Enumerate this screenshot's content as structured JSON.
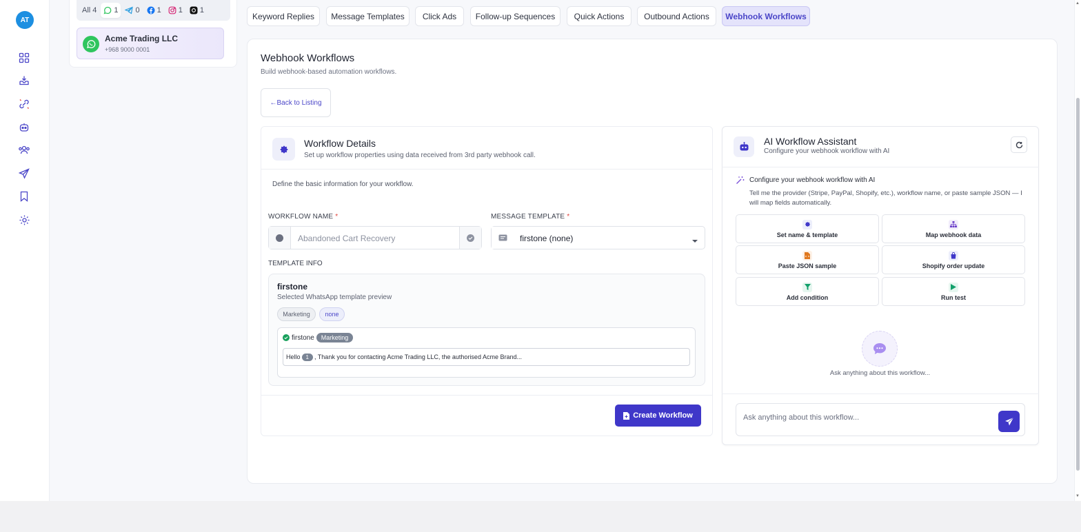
{
  "user": {
    "initials": "AT"
  },
  "rail": [
    "dashboard-icon",
    "inbox-icon",
    "integrations-icon",
    "bot-icon",
    "contacts-icon",
    "send-icon",
    "bookmark-icon",
    "settings-icon"
  ],
  "channels": {
    "tabs": [
      {
        "label": "All",
        "count": "4",
        "icon": "all"
      },
      {
        "label": "",
        "count": "1",
        "icon": "whatsapp-icon"
      },
      {
        "label": "",
        "count": "0",
        "icon": "telegram-icon"
      },
      {
        "label": "",
        "count": "1",
        "icon": "facebook-icon"
      },
      {
        "label": "",
        "count": "1",
        "icon": "instagram-icon"
      },
      {
        "label": "",
        "count": "1",
        "icon": "threads-icon"
      }
    ],
    "card": {
      "name": "Acme Trading LLC",
      "phone": "+968 9000 0001"
    }
  },
  "top_tabs": [
    "Keyword Replies",
    "Message Templates",
    "Click Ads",
    "Follow-up Sequences",
    "Quick Actions",
    "Outbound Actions",
    "Webhook Workflows"
  ],
  "page": {
    "title": "Webhook Workflows",
    "subtitle": "Build webhook-based automation workflows.",
    "back_label": "Back to Listing"
  },
  "workflow": {
    "title": "Workflow Details",
    "subtitle": "Set up workflow properties using data received from 3rd party webhook call.",
    "define": "Define the basic information for your workflow.",
    "name_label": "WORKFLOW NAME",
    "name_placeholder": "Abandoned Cart Recovery",
    "template_label": "MESSAGE TEMPLATE",
    "template_value": "firstone (none)",
    "required_mark": "*",
    "template_info_label": "TEMPLATE INFO",
    "template_name": "firstone",
    "template_desc": "Selected WhatsApp template preview",
    "chips": [
      "Marketing",
      "none"
    ],
    "preview_name": "firstone",
    "preview_badge": "Marketing",
    "preview_hello": "Hello",
    "preview_var": "1",
    "preview_text": ", Thank you for contacting Acme Trading LLC, the authorised Acme Brand...",
    "create_label": "Create Workflow"
  },
  "ai": {
    "title": "AI Workflow Assistant",
    "subtitle": "Configure your webhook workflow with AI",
    "configure": "Configure your webhook workflow with AI",
    "desc": "Tell me the provider (Stripe, PayPal, Shopify, etc.), workflow name, or paste sample JSON — I will map fields automatically.",
    "actions": [
      {
        "label": "Set name & template",
        "icon": "gear-icon",
        "color": "#3f37c9",
        "bg": "#eceefb"
      },
      {
        "label": "Map webhook data",
        "icon": "sitemap-icon",
        "color": "#6b3fc9",
        "bg": "#f1ecfb"
      },
      {
        "label": "Paste JSON sample",
        "icon": "file-code-icon",
        "color": "#e0781e",
        "bg": "#fdf1e6"
      },
      {
        "label": "Shopify order update",
        "icon": "shopping-bag-icon",
        "color": "#3f37c9",
        "bg": "#eceefb"
      },
      {
        "label": "Add condition",
        "icon": "filter-icon",
        "color": "#12a06b",
        "bg": "#e5f6ef"
      },
      {
        "label": "Run test",
        "icon": "play-icon",
        "color": "#12a06b",
        "bg": "#e5f6ef"
      }
    ],
    "ask_hint": "Ask anything about this workflow...",
    "input_placeholder": "Ask anything about this workflow..."
  }
}
